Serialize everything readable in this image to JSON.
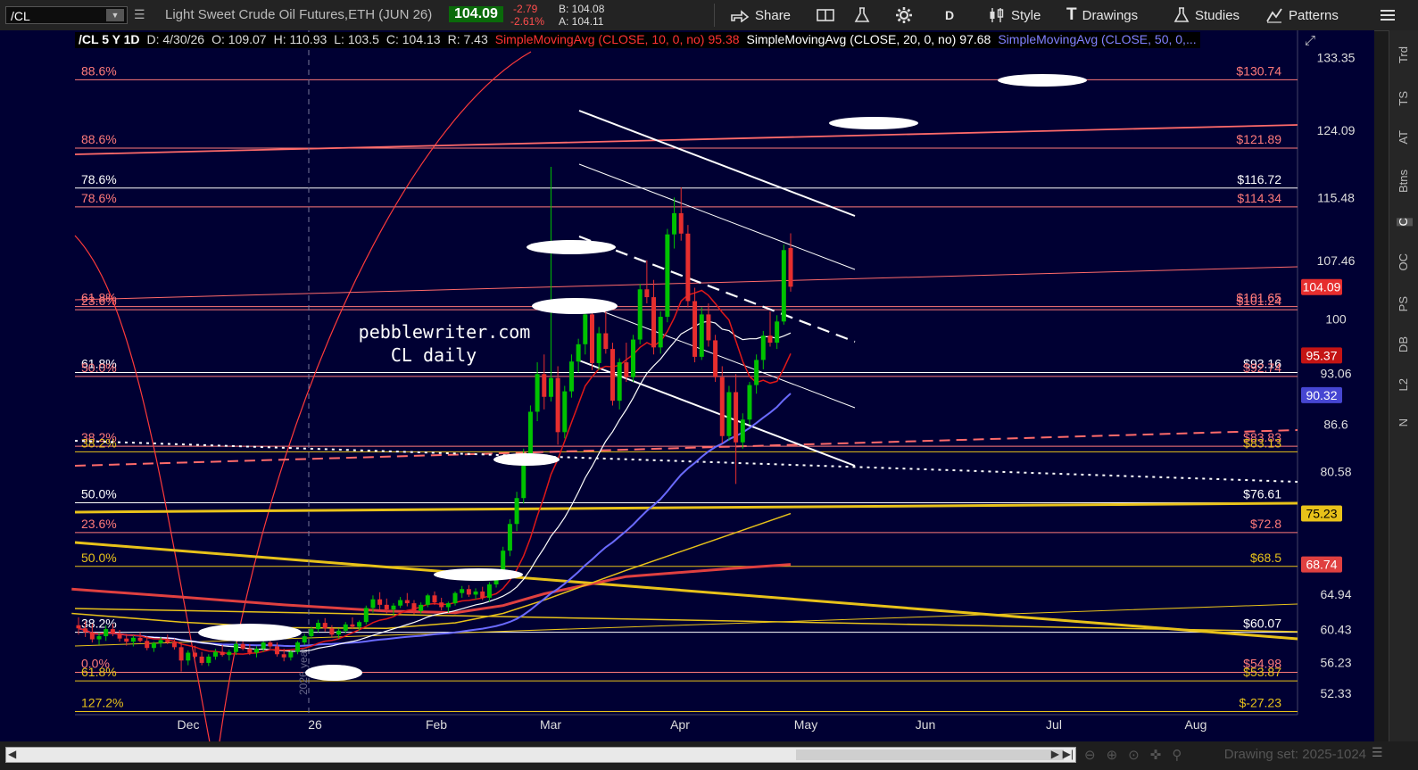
{
  "toolbar": {
    "symbol": "/CL",
    "description": "Light Sweet Crude Oil Futures,ETH (JUN 26)",
    "last": "104.09",
    "change": "-2.79",
    "change_pct": "-2.61%",
    "bid": "B: 104.08",
    "ask": "A: 104.11",
    "share": "Share",
    "aggregation": "D",
    "style": "Style",
    "drawings": "Drawings",
    "studies": "Studies",
    "patterns": "Patterns"
  },
  "header": {
    "symbol_period": "/CL 5 Y 1D",
    "date": "D: 4/30/26",
    "open": "O: 109.07",
    "high": "H: 110.93",
    "low": "L: 103.5",
    "close": "C: 104.13",
    "range": "R: 7.43",
    "sma10": "SimpleMovingAvg (CLOSE, 10, 0, no)",
    "sma10_val": "95.38",
    "sma20": "SimpleMovingAvg (CLOSE, 20, 0, no)",
    "sma20_val": "97.68",
    "sma50": "SimpleMovingAvg (CLOSE, 50, 0,..."
  },
  "right_rail": [
    "Trd",
    "TS",
    "AT",
    "Btns",
    "C",
    "OC",
    "PS",
    "DB",
    "L2",
    "N"
  ],
  "bottom": {
    "drawing_set": "Drawing set: 2025-1024"
  },
  "colors": {
    "background": "#000033",
    "up": "#00c200",
    "down": "#e62e2e",
    "sma10": "#e01818",
    "sma20": "#ffffff",
    "sma50": "#6a6aff",
    "gold": "#e8c21a",
    "pink": "#ff7a7a"
  },
  "chart_data": {
    "type": "candlestick",
    "title": "pebblewriter.com",
    "subtitle": "CL daily",
    "x_ticks": [
      "Dec",
      "26",
      "Feb",
      "Mar",
      "Apr",
      "May",
      "Jun",
      "Jul",
      "Aug"
    ],
    "y_ticks": [
      133.35,
      124.09,
      115.48,
      107.46,
      100,
      93.06,
      86.6,
      80.58,
      64.94,
      60.43,
      56.23,
      52.33
    ],
    "ylim": [
      49.6,
      136.8
    ],
    "price_tags": [
      {
        "value": "104.09",
        "color": "#e62e2e"
      },
      {
        "value": "95.37",
        "color": "#c41414"
      },
      {
        "value": "90.32",
        "color": "#4646d2"
      },
      {
        "value": "75.23",
        "color": "#e8c21a"
      },
      {
        "value": "68.74",
        "color": "#e04040"
      }
    ],
    "fib_levels": [
      {
        "pct": "88.6%",
        "value": "$130.74",
        "y": 130.5,
        "color": "#ff7a7a"
      },
      {
        "pct": "88.6%",
        "value": "$121.89",
        "y": 121.8,
        "color": "#ff7a7a"
      },
      {
        "pct": "78.6%",
        "value": "$116.72",
        "y": 116.7,
        "color": "#ffffff"
      },
      {
        "pct": "78.6%",
        "value": "$114.34",
        "y": 114.3,
        "color": "#ff7a7a"
      },
      {
        "pct": "61.8%",
        "value": "$101.65",
        "y": 101.6,
        "color": "#ff7a7a"
      },
      {
        "pct": "23.6%",
        "value": "$101.24",
        "y": 101.2,
        "color": "#ff7a7a"
      },
      {
        "pct": "61.8%",
        "value": "$93.16",
        "y": 93.2,
        "color": "#ffffff"
      },
      {
        "pct": "50.0%",
        "value": "$92.74",
        "y": 92.7,
        "color": "#ff7a7a"
      },
      {
        "pct": "38.2%",
        "value": "$83.83",
        "y": 83.8,
        "color": "#ff7a7a"
      },
      {
        "pct": "38.2%",
        "value": "$83.13",
        "y": 83.1,
        "color": "#e8c21a"
      },
      {
        "pct": "50.0%",
        "value": "$76.61",
        "y": 76.6,
        "color": "#ffffff"
      },
      {
        "pct": "23.6%",
        "value": "$72.8",
        "y": 72.8,
        "color": "#ff7a7a"
      },
      {
        "pct": "50.0%",
        "value": "$68.5",
        "y": 68.5,
        "color": "#e8c21a"
      },
      {
        "pct": "38.2%",
        "value": "$60.07",
        "y": 60.1,
        "color": "#ffffff"
      },
      {
        "pct": "0.0%",
        "value": "$54.98",
        "y": 55.0,
        "color": "#ff7a7a"
      },
      {
        "pct": "61.8%",
        "value": "$53.87",
        "y": 53.9,
        "color": "#e8c21a"
      },
      {
        "pct": "127.2%",
        "value": "$-27.23",
        "y": 50.0,
        "color": "#e8c21a"
      }
    ],
    "candles": [
      [
        61.0,
        62.0,
        59.8,
        60.6
      ],
      [
        60.6,
        61.5,
        59.5,
        60.1
      ],
      [
        60.1,
        61.2,
        58.8,
        59.2
      ],
      [
        59.2,
        60.0,
        58.5,
        59.6
      ],
      [
        59.6,
        61.0,
        59.0,
        60.5
      ],
      [
        60.5,
        61.2,
        59.6,
        59.9
      ],
      [
        59.9,
        60.4,
        58.9,
        59.3
      ],
      [
        59.3,
        59.9,
        58.4,
        58.9
      ],
      [
        58.9,
        59.7,
        58.3,
        59.4
      ],
      [
        59.4,
        60.1,
        58.8,
        59.0
      ],
      [
        59.0,
        59.6,
        57.8,
        58.1
      ],
      [
        58.1,
        58.9,
        57.6,
        58.7
      ],
      [
        58.7,
        59.5,
        58.2,
        59.1
      ],
      [
        59.1,
        59.8,
        58.6,
        58.8
      ],
      [
        58.8,
        59.3,
        57.9,
        58.2
      ],
      [
        58.2,
        58.8,
        55.1,
        56.5
      ],
      [
        56.5,
        57.8,
        55.9,
        57.5
      ],
      [
        57.5,
        58.4,
        56.8,
        57.0
      ],
      [
        57.0,
        57.6,
        55.9,
        56.2
      ],
      [
        56.2,
        57.3,
        55.8,
        57.0
      ],
      [
        57.0,
        58.0,
        56.6,
        57.6
      ],
      [
        57.6,
        58.5,
        57.0,
        57.2
      ],
      [
        57.2,
        57.9,
        56.5,
        57.6
      ],
      [
        57.6,
        58.9,
        57.2,
        58.6
      ],
      [
        58.6,
        59.2,
        57.8,
        58.0
      ],
      [
        58.0,
        58.6,
        57.2,
        57.5
      ],
      [
        57.5,
        58.3,
        56.9,
        58.0
      ],
      [
        58.0,
        59.0,
        57.6,
        58.8
      ],
      [
        58.8,
        59.4,
        58.0,
        58.3
      ],
      [
        58.3,
        58.8,
        57.0,
        57.3
      ],
      [
        57.3,
        58.0,
        56.4,
        56.9
      ],
      [
        56.9,
        57.8,
        56.5,
        57.6
      ],
      [
        57.6,
        59.0,
        57.3,
        58.8
      ],
      [
        58.8,
        59.9,
        58.5,
        59.6
      ],
      [
        59.6,
        60.8,
        59.3,
        60.5
      ],
      [
        60.5,
        61.7,
        60.1,
        61.3
      ],
      [
        61.3,
        61.9,
        60.2,
        60.6
      ],
      [
        60.6,
        61.0,
        59.4,
        59.8
      ],
      [
        59.8,
        60.6,
        59.3,
        60.3
      ],
      [
        60.3,
        61.4,
        60.0,
        61.1
      ],
      [
        61.1,
        62.0,
        60.5,
        60.8
      ],
      [
        60.8,
        61.6,
        60.3,
        61.4
      ],
      [
        61.4,
        63.5,
        61.1,
        63.2
      ],
      [
        63.2,
        64.8,
        62.6,
        64.3
      ],
      [
        64.3,
        65.2,
        63.0,
        63.6
      ],
      [
        63.6,
        64.4,
        62.5,
        63.0
      ],
      [
        63.0,
        63.8,
        62.2,
        63.5
      ],
      [
        63.5,
        64.6,
        63.2,
        64.2
      ],
      [
        64.2,
        65.1,
        63.4,
        63.8
      ],
      [
        63.8,
        64.2,
        62.4,
        62.8
      ],
      [
        62.8,
        63.9,
        62.5,
        63.6
      ],
      [
        63.6,
        65.0,
        63.3,
        64.8
      ],
      [
        64.8,
        65.3,
        63.6,
        63.9
      ],
      [
        63.9,
        64.5,
        62.9,
        63.3
      ],
      [
        63.3,
        64.0,
        62.6,
        63.8
      ],
      [
        63.8,
        65.3,
        63.5,
        65.1
      ],
      [
        65.1,
        66.0,
        64.5,
        65.6
      ],
      [
        65.6,
        66.1,
        64.6,
        64.9
      ],
      [
        64.9,
        65.7,
        64.3,
        65.3
      ],
      [
        65.3,
        65.9,
        64.2,
        64.5
      ],
      [
        64.5,
        66.5,
        64.0,
        66.2
      ],
      [
        66.2,
        68.0,
        65.8,
        67.6
      ],
      [
        67.6,
        71.0,
        67.0,
        70.5
      ],
      [
        70.5,
        74.5,
        69.8,
        73.9
      ],
      [
        73.9,
        78.0,
        73.0,
        77.2
      ],
      [
        77.2,
        83.5,
        76.5,
        82.8
      ],
      [
        82.8,
        89.0,
        81.5,
        88.2
      ],
      [
        88.2,
        94.5,
        87.0,
        93.0
      ],
      [
        93.0,
        95.5,
        88.5,
        90.1
      ],
      [
        90.1,
        119.4,
        89.5,
        92.5
      ],
      [
        92.5,
        94.0,
        84.0,
        85.6
      ],
      [
        85.6,
        91.5,
        84.8,
        90.8
      ],
      [
        90.8,
        95.5,
        90.0,
        94.6
      ],
      [
        94.6,
        97.5,
        93.2,
        96.8
      ],
      [
        96.8,
        101.5,
        95.5,
        100.6
      ],
      [
        100.6,
        101.8,
        93.5,
        94.4
      ],
      [
        94.4,
        99.0,
        93.5,
        98.2
      ],
      [
        98.2,
        101.2,
        95.6,
        96.2
      ],
      [
        96.2,
        97.0,
        89.0,
        89.6
      ],
      [
        89.6,
        95.0,
        88.5,
        94.5
      ],
      [
        94.5,
        97.0,
        92.0,
        92.6
      ],
      [
        92.6,
        98.0,
        92.0,
        97.4
      ],
      [
        97.4,
        104.5,
        96.8,
        103.8
      ],
      [
        103.8,
        107.5,
        102.0,
        102.8
      ],
      [
        102.8,
        105.0,
        95.5,
        96.4
      ],
      [
        96.4,
        101.0,
        95.6,
        100.3
      ],
      [
        100.3,
        111.5,
        99.6,
        110.8
      ],
      [
        110.8,
        115.5,
        109.0,
        113.5
      ],
      [
        113.5,
        116.8,
        110.0,
        110.9
      ],
      [
        110.9,
        112.0,
        101.5,
        102.3
      ],
      [
        102.3,
        104.0,
        94.5,
        95.2
      ],
      [
        95.2,
        101.5,
        94.8,
        100.6
      ],
      [
        100.6,
        102.0,
        96.5,
        97.3
      ],
      [
        97.3,
        98.0,
        92.0,
        92.6
      ],
      [
        92.6,
        94.0,
        84.2,
        85.1
      ],
      [
        85.1,
        91.5,
        84.5,
        90.7
      ],
      [
        90.7,
        93.0,
        79.0,
        84.3
      ],
      [
        84.3,
        88.0,
        83.5,
        87.2
      ],
      [
        87.2,
        92.0,
        86.5,
        91.6
      ],
      [
        91.6,
        95.5,
        90.5,
        94.8
      ],
      [
        94.8,
        98.5,
        93.6,
        97.9
      ],
      [
        97.9,
        101.0,
        96.5,
        97.0
      ],
      [
        97.0,
        100.5,
        96.2,
        99.7
      ],
      [
        99.7,
        109.5,
        99.3,
        108.8
      ],
      [
        109.07,
        110.93,
        103.5,
        104.13
      ]
    ]
  }
}
